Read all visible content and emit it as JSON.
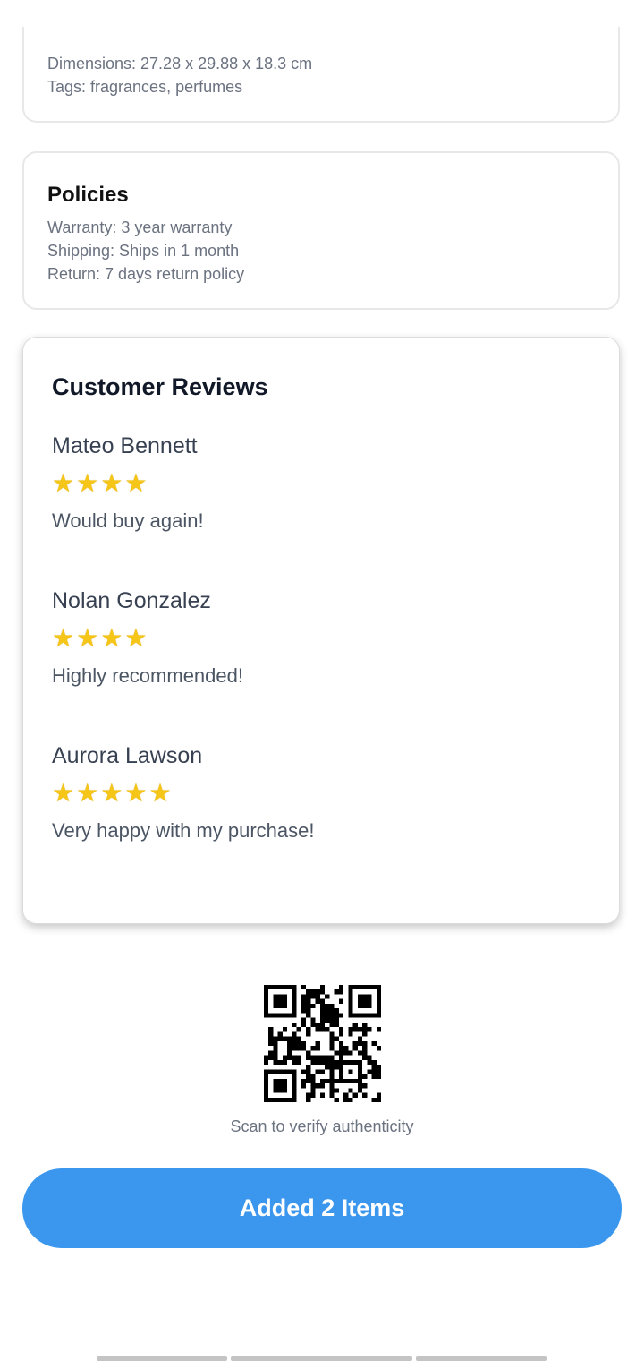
{
  "details": {
    "dimensions": "Dimensions: 27.28 x 29.88 x 18.3 cm",
    "tags": "Tags: fragrances, perfumes"
  },
  "policies": {
    "title": "Policies",
    "warranty": "Warranty: 3 year warranty",
    "shipping": "Shipping: Ships in 1 month",
    "return": "Return: 7 days return policy"
  },
  "reviews": {
    "title": "Customer Reviews",
    "items": [
      {
        "name": "Mateo Bennett",
        "rating": 4,
        "text": "Would buy again!"
      },
      {
        "name": "Nolan Gonzalez",
        "rating": 4,
        "text": "Highly recommended!"
      },
      {
        "name": "Aurora Lawson",
        "rating": 5,
        "text": "Very happy with my purchase!"
      }
    ]
  },
  "qr": {
    "icon": "qr-code-icon",
    "caption": "Scan to verify authenticity"
  },
  "cta": {
    "label": "Added 2 Items",
    "color": "#3b97ed"
  },
  "colors": {
    "star": "#f5c518",
    "text_muted": "#6b7280"
  }
}
